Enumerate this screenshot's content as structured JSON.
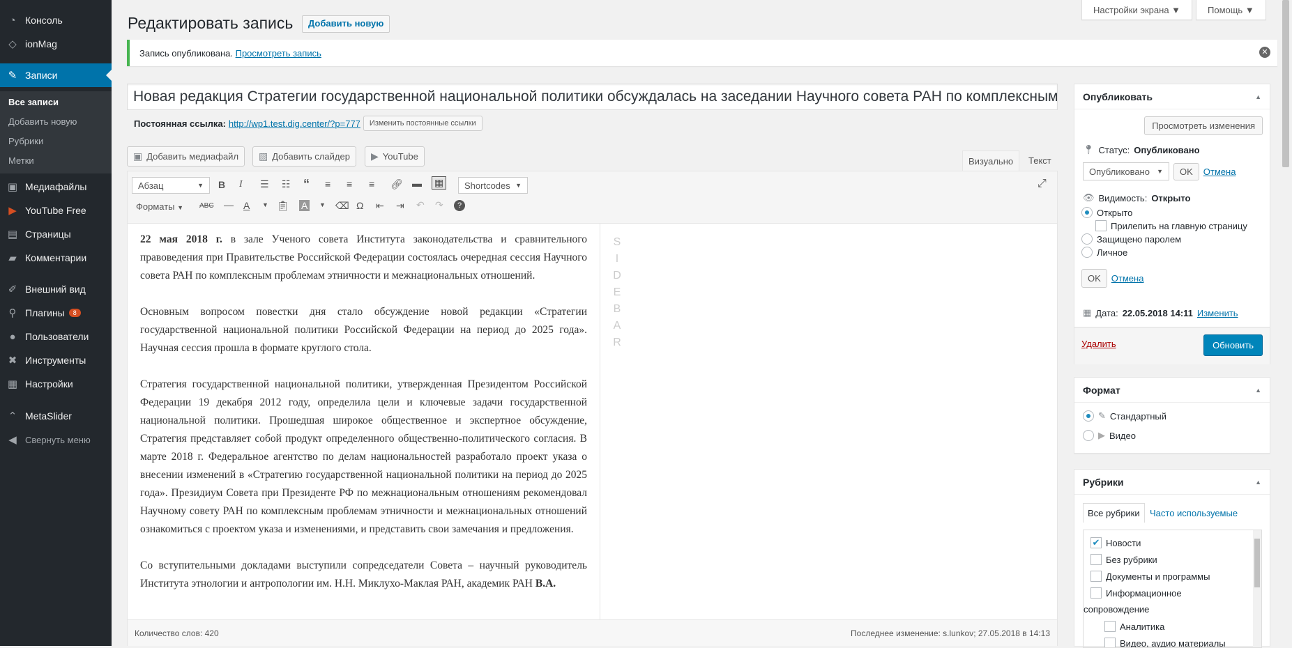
{
  "admin_menu": {
    "items_top": [
      {
        "label": "Консоль",
        "icon": "dashboard-icon"
      },
      {
        "label": "ionMag",
        "icon": "ionmag-icon"
      }
    ],
    "current": {
      "label": "Записи",
      "icon": "pushpin-icon"
    },
    "submenu": [
      "Все записи",
      "Добавить новую",
      "Рубрики",
      "Метки"
    ],
    "items_bottom": [
      {
        "label": "Медиафайлы",
        "icon": "media-icon"
      },
      {
        "label": "YouTube Free",
        "icon": "youtube-icon"
      },
      {
        "label": "Страницы",
        "icon": "page-icon"
      },
      {
        "label": "Комментарии",
        "icon": "comment-icon"
      },
      {
        "label": "Внешний вид",
        "icon": "brush-icon"
      },
      {
        "label": "Плагины",
        "icon": "plugin-icon",
        "badge": "8"
      },
      {
        "label": "Пользователи",
        "icon": "users-icon"
      },
      {
        "label": "Инструменты",
        "icon": "tools-icon"
      },
      {
        "label": "Настройки",
        "icon": "settings-icon"
      },
      {
        "label": "MetaSlider",
        "icon": "metaslider-icon"
      }
    ],
    "collapse": "Свернуть меню"
  },
  "header": {
    "title": "Редактировать запись",
    "add_new": "Добавить новую",
    "screen_options": "Настройки экрана ▼",
    "help": "Помощь ▼"
  },
  "notice": {
    "text": "Запись опубликована.",
    "link": "Просмотреть запись"
  },
  "post": {
    "title": "Новая редакция Стратегии государственной национальной политики обсуждалась на заседании Научного совета РАН по комплексным проблемам этничности и межнациональных отношений",
    "permalink_label": "Постоянная ссылка:",
    "permalink_url": "http://wp1.test.dig.center/?p=777",
    "permalink_btn": "Изменить постоянные ссылки"
  },
  "media_buttons": {
    "add_media": "Добавить медиафайл",
    "add_slider": "Добавить слайдер",
    "youtube": "YouTube"
  },
  "editor_tabs": {
    "visual": "Визуально",
    "text": "Текст"
  },
  "toolbar": {
    "format_select": "Абзац",
    "shortcodes": "Shortcodes",
    "formats": "Форматы"
  },
  "content": {
    "p1_bold": "22 мая 2018 г.",
    "p1": " в зале Ученого совета Института законодательства и сравнительного правоведения при Правительстве Российской Федерации состоялась очередная сессия Научного совета РАН по комплексным проблемам этничности и межнациональных отношений.",
    "p2": "Основным вопросом повестки дня стало обсуждение новой редакции «Стратегии государственной национальной политики Российской Федерации на период до 2025 года». Научная сессия прошла в формате круглого стола.",
    "p3": "Стратегия государственной национальной политики, утвержденная Президентом Российской Федерации 19 декабря 2012 году, определила цели и ключевые задачи государственной национальной политики. Прошедшая широкое общественное и экспертное обсуждение, Стратегия представляет собой продукт определенного общественно-политического согласия. В марте 2018 г. Федеральное агентство по делам национальностей разработало проект указа о внесении изменений в «Стратегию государственной национальной политики на период до 2025 года». Президиум Совета при Президенте РФ по межнациональным отношениям рекомендовал Научному совету РАН по комплексным проблемам этничности и межнациональных отношений ознакомиться с проектом указа и изменениями, и представить свои замечания и предложения.",
    "p4": "Со вступительными докладами выступили сопредседатели Совета – научный руководитель Института этнологии и антропологии им. Н.Н. Миклухо-Маклая РАН, академик РАН ",
    "p4_bold": "В.А.",
    "sidebar_marker": "SIDEBAR"
  },
  "status": {
    "word_count": "Количество слов: 420",
    "last_edit": "Последнее изменение: s.lunkov; 27.05.2018 в 14:13"
  },
  "publish": {
    "title": "Опубликовать",
    "preview": "Просмотреть изменения",
    "status_label": "Статус:",
    "status_value": "Опубликовано",
    "status_select": "Опубликовано",
    "ok": "OK",
    "cancel": "Отмена",
    "visibility_label": "Видимость:",
    "visibility_value": "Открыто",
    "opt_open": "Открыто",
    "opt_sticky": "Прилепить на главную страницу",
    "opt_password": "Защищено паролем",
    "opt_private": "Личное",
    "date_label": "Дата:",
    "date_value": "22.05.2018 14:11",
    "date_change": "Изменить",
    "delete": "Удалить",
    "update": "Обновить"
  },
  "format_box": {
    "title": "Формат",
    "standard": "Стандартный",
    "video": "Видео"
  },
  "categories_box": {
    "title": "Рубрики",
    "tab_all": "Все рубрики",
    "tab_popular": "Часто используемые",
    "items": [
      {
        "label": "Новости",
        "checked": true
      },
      {
        "label": "Без рубрики",
        "checked": false
      },
      {
        "label": "Документы и программы",
        "checked": false
      },
      {
        "label": "Информационное",
        "checked": false
      },
      {
        "label": "сопровождение",
        "checked": false
      },
      {
        "label": "Аналитика",
        "checked": false
      },
      {
        "label": "Видео, аудио материалы",
        "checked": false
      }
    ]
  },
  "colors": {
    "accent": "#0073aa",
    "menu_bg": "#23282d",
    "notice_success": "#46b450",
    "primary_btn": "#0085ba"
  }
}
